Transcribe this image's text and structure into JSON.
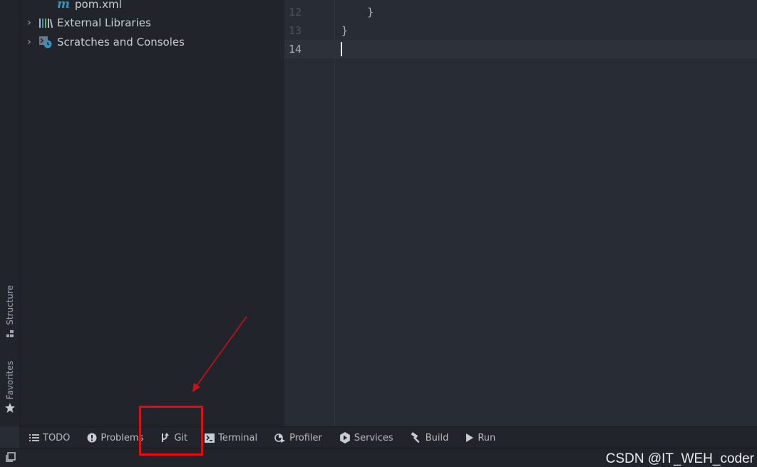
{
  "project_tree": {
    "items": [
      {
        "label": "pom.xml",
        "icon": "maven-file-icon"
      },
      {
        "label": "External Libraries",
        "icon": "libraries-icon"
      },
      {
        "label": "Scratches and Consoles",
        "icon": "scratches-icon"
      }
    ]
  },
  "side_tabs": {
    "structure": "Structure",
    "favorites": "Favorites"
  },
  "editor": {
    "lines": [
      {
        "number": "12",
        "code": "    }"
      },
      {
        "number": "13",
        "code": "}"
      },
      {
        "number": "14",
        "code": ""
      }
    ],
    "current_line": "14"
  },
  "tool_windows": {
    "todo": "TODO",
    "problems": "Problems",
    "git": "Git",
    "terminal": "Terminal",
    "profiler": "Profiler",
    "services": "Services",
    "build": "Build",
    "run": "Run"
  },
  "watermark": "CSDN @IT_WEH_coder",
  "colors": {
    "highlight": "#ff0000",
    "accent_blue": "#3592c4"
  }
}
